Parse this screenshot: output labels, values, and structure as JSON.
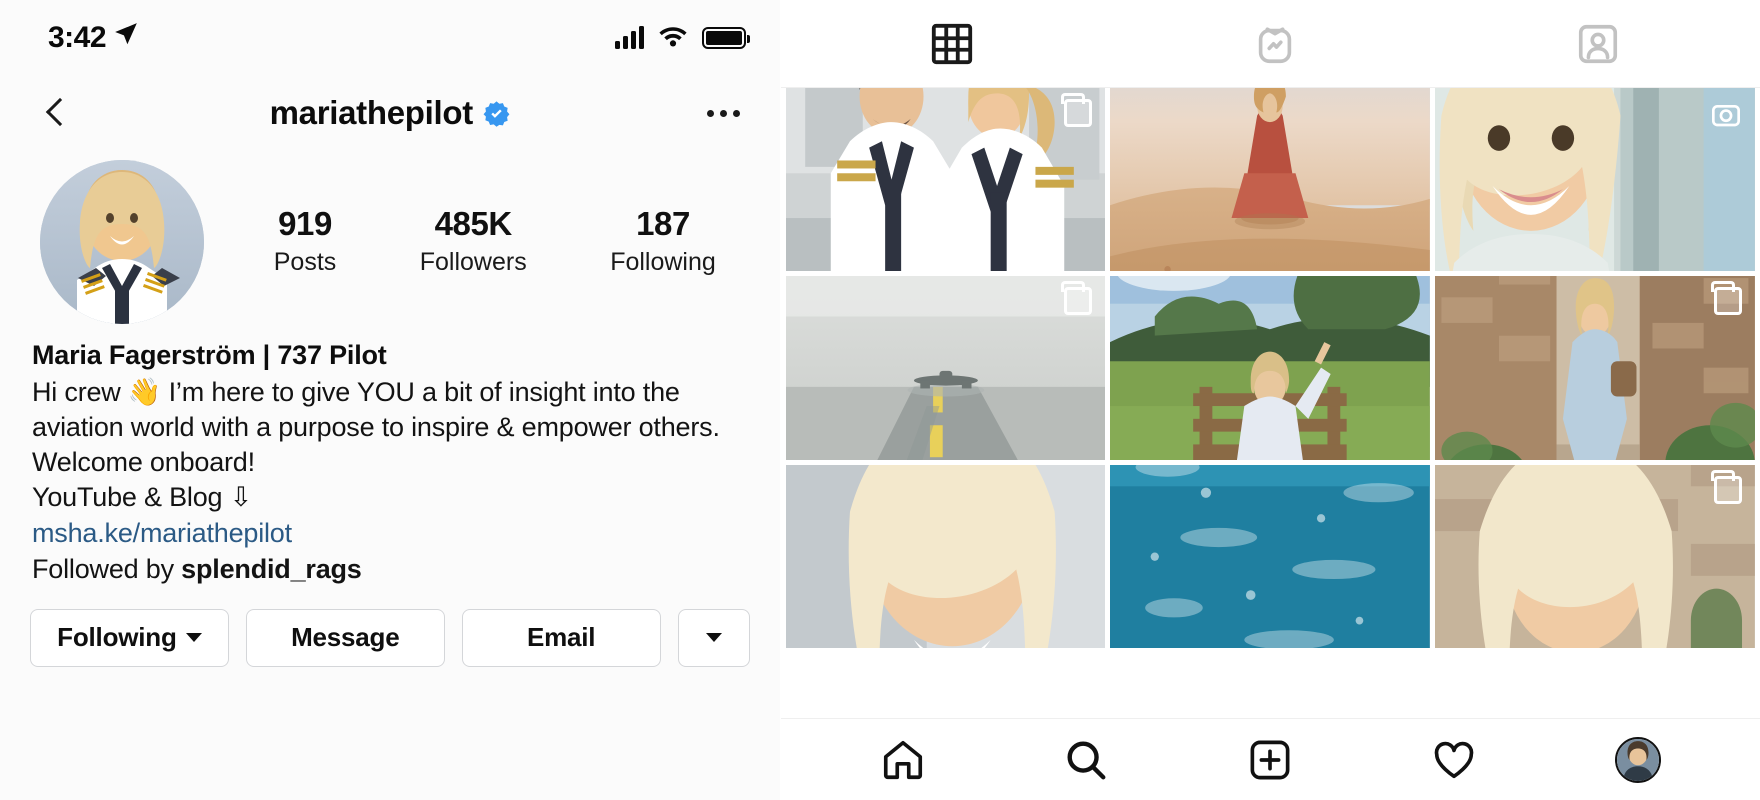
{
  "status_bar": {
    "time": "3:42",
    "location_icon": "location-arrow-icon",
    "signal_icon": "cellular-signal-icon",
    "wifi_icon": "wifi-icon",
    "battery_icon": "battery-full-icon"
  },
  "nav": {
    "back_icon": "back-chevron-icon",
    "username": "mariathepilot",
    "verified_icon": "verified-badge-icon",
    "more_icon": "more-options-icon"
  },
  "profile": {
    "avatar_alt": "profile-photo",
    "stats": [
      {
        "value": "919",
        "label": "Posts"
      },
      {
        "value": "485K",
        "label": "Followers"
      },
      {
        "value": "187",
        "label": "Following"
      }
    ],
    "full_name": "Maria Fagerström | 737 Pilot",
    "bio_lines": [
      "Hi crew 👋 I’m here to give YOU a bit of insight into the",
      "aviation world with a purpose to inspire & empower others.",
      "Welcome onboard!",
      "YouTube & Blog ⇩"
    ],
    "link": "msha.ke/mariathepilot",
    "followed_by_prefix": "Followed by ",
    "followed_by_user": "splendid_rags"
  },
  "actions": {
    "following_label": "Following",
    "message_label": "Message",
    "email_label": "Email",
    "more_label": ""
  },
  "tabs": [
    {
      "name": "grid-tab",
      "icon": "grid-icon",
      "active": true
    },
    {
      "name": "igtv-tab",
      "icon": "igtv-icon",
      "active": false
    },
    {
      "name": "tagged-tab",
      "icon": "tagged-person-icon",
      "active": false
    }
  ],
  "grid": [
    {
      "id": "post-1",
      "badge": "multi-post-icon",
      "alt": "two pilots facing each other in aircraft cabin"
    },
    {
      "id": "post-2",
      "badge": "",
      "alt": "woman in red dress standing on desert dune at sunset"
    },
    {
      "id": "post-3",
      "badge": "camera-icon",
      "alt": "smiling blonde woman in helicopter cockpit"
    },
    {
      "id": "post-4",
      "badge": "multi-post-icon",
      "alt": "airplane on foggy runway with centerline markings"
    },
    {
      "id": "post-5",
      "badge": "",
      "alt": "person sitting on wooden bench in green field"
    },
    {
      "id": "post-6",
      "badge": "multi-post-icon",
      "alt": "woman walking down stone village alley with plants"
    },
    {
      "id": "post-7",
      "badge": "",
      "alt": "close-up portrait partially visible"
    },
    {
      "id": "post-8",
      "badge": "",
      "alt": "blue swimming pool water"
    },
    {
      "id": "post-9",
      "badge": "multi-post-icon",
      "alt": "portrait with stone wall background"
    }
  ],
  "bottom_nav": [
    {
      "name": "home-nav",
      "icon": "home-icon"
    },
    {
      "name": "search-nav",
      "icon": "search-icon"
    },
    {
      "name": "create-nav",
      "icon": "plus-square-icon"
    },
    {
      "name": "activity-nav",
      "icon": "heart-icon"
    },
    {
      "name": "profile-nav",
      "icon": "profile-avatar-icon"
    }
  ],
  "colors": {
    "verified_blue": "#3797f0",
    "link_blue": "#2b5a85",
    "text": "#121212",
    "border": "#d4d6d9"
  }
}
